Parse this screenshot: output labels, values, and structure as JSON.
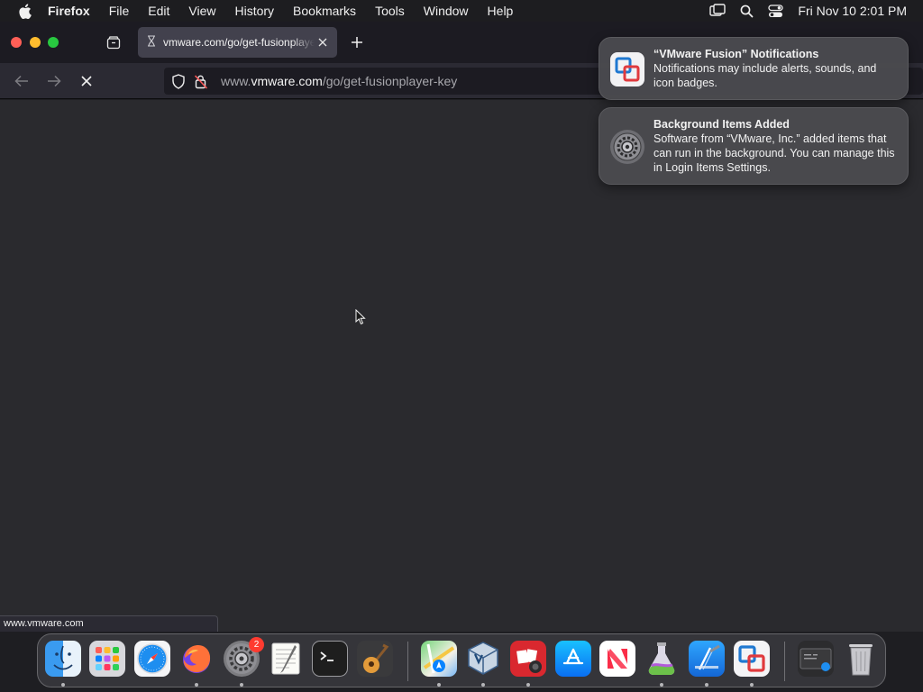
{
  "menubar": {
    "app_name": "Firefox",
    "menus": [
      "File",
      "Edit",
      "View",
      "History",
      "Bookmarks",
      "Tools",
      "Window",
      "Help"
    ],
    "clock": "Fri Nov 10  2:01 PM"
  },
  "browser": {
    "tab_title": "vmware.com/go/get-fusionplayer-key",
    "url_prefix": "www.",
    "url_domain": "vmware.com",
    "url_path": "/go/get-fusionplayer-key",
    "status_url": "www.vmware.com"
  },
  "notifications": [
    {
      "title": "“VMware Fusion” Notifications",
      "body": "Notifications may include alerts, sounds, and icon badges.",
      "icon": "vmware-fusion-icon"
    },
    {
      "title": "Background Items Added",
      "body": "Software from “VMware, Inc.” added items that can run in the background. You can manage this in Login Items Settings.",
      "icon": "system-settings-icon"
    }
  ],
  "dock": {
    "settings_badge": "2",
    "apps": [
      "Finder",
      "Launchpad",
      "Safari",
      "Firefox",
      "System Settings",
      "TextEdit",
      "Terminal",
      "GarageBand",
      "Maps",
      "VirtualBox",
      "Photo Booth",
      "App Store",
      "News",
      "Xcode Cloud",
      "Xcode",
      "VMware Fusion",
      "Downloads",
      "Trash"
    ]
  },
  "colors": {
    "background": "#2a2a2e",
    "toolbar": "#2b2a33",
    "accent": "#0a84ff"
  }
}
